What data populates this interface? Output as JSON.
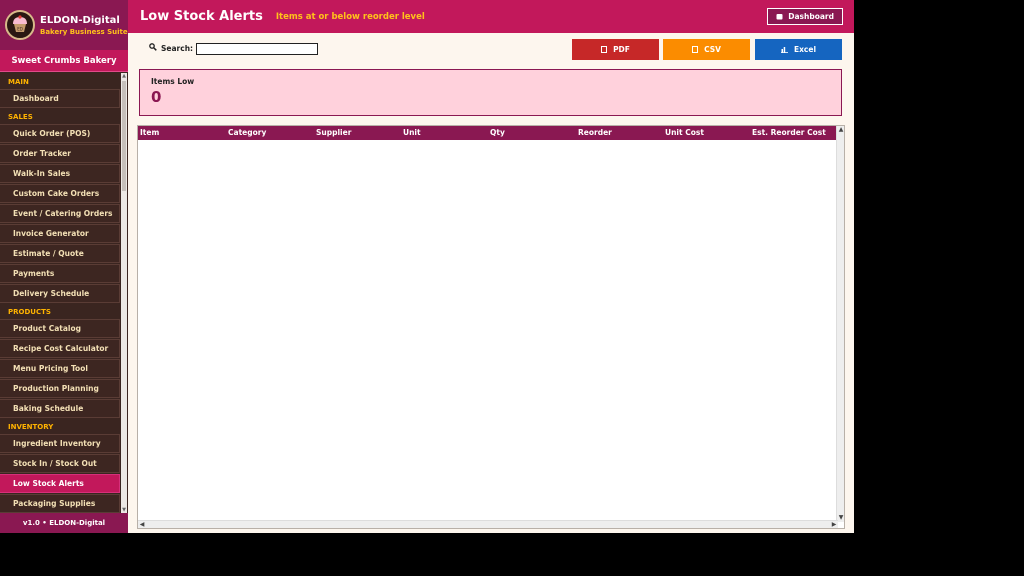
{
  "app": {
    "title": "ELDON-Digital",
    "subtitle": "Bakery Business Suite",
    "logo_badge": "ED",
    "business_name": "Sweet Crumbs Bakery",
    "footer": "v1.0  •  ELDON-Digital"
  },
  "nav": {
    "main_label": "MAIN",
    "main": [
      "Dashboard"
    ],
    "sales_label": "SALES",
    "sales": [
      "Quick Order (POS)",
      "Order Tracker",
      "Walk-In Sales",
      "Custom Cake Orders",
      "Event / Catering Orders",
      "Invoice Generator",
      "Estimate / Quote",
      "Payments",
      "Delivery Schedule"
    ],
    "products_label": "PRODUCTS",
    "products": [
      "Product Catalog",
      "Recipe Cost Calculator",
      "Menu Pricing Tool",
      "Production Planning",
      "Baking Schedule"
    ],
    "inventory_label": "INVENTORY",
    "inventory": [
      "Ingredient Inventory",
      "Stock In / Stock Out",
      "Low Stock Alerts",
      "Packaging Supplies"
    ],
    "active": "Low Stock Alerts"
  },
  "header": {
    "title": "Low Stock Alerts",
    "subtitle": "Items at or below reorder level",
    "dashboard_button": "Dashboard"
  },
  "toolbar": {
    "search_label": "Search:",
    "search_value": "",
    "pdf": "PDF",
    "csv": "CSV",
    "excel": "Excel"
  },
  "summary": {
    "label": "Items Low",
    "value": "0"
  },
  "table": {
    "columns": [
      "Item",
      "Category",
      "Supplier",
      "Unit",
      "Qty",
      "Reorder",
      "Unit Cost",
      "Est. Reorder Cost"
    ],
    "rows": []
  },
  "colors": {
    "primary": "#c2185b",
    "dark": "#8a1852",
    "sidebar": "#3a2520",
    "accent": "#ffc21a",
    "pdf": "#c62828",
    "csv": "#fb8c00",
    "excel": "#1565c0"
  }
}
